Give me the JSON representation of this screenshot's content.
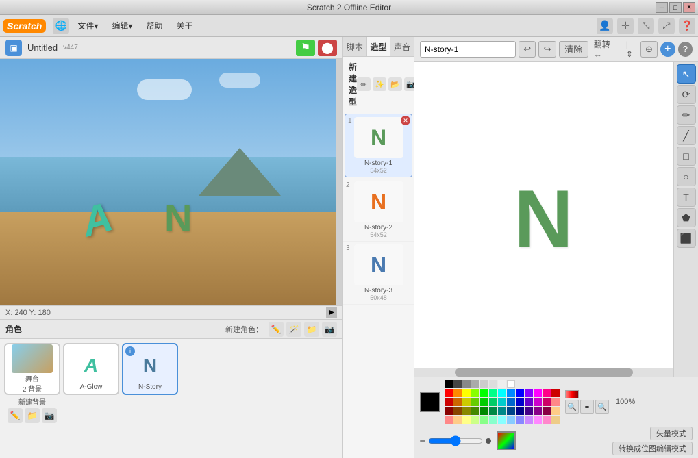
{
  "titlebar": {
    "title": "Scratch 2 Offline Editor"
  },
  "menubar": {
    "logo": "Scratch",
    "items": [
      "文件▾",
      "编辑▾",
      "帮助",
      "关于"
    ]
  },
  "stage": {
    "title": "Untitled",
    "version": "v447",
    "coords": "X: 240  Y: 180"
  },
  "tabs": {
    "scripts": "脚本",
    "costumes": "造型",
    "sounds": "声音"
  },
  "costumes": {
    "header": "新建造型",
    "items": [
      {
        "num": "1",
        "name": "N-story-1",
        "size": "54x52"
      },
      {
        "num": "2",
        "name": "N-story-2",
        "size": "54x52"
      },
      {
        "num": "3",
        "name": "N-story-3",
        "size": "50x48"
      }
    ]
  },
  "paint_editor": {
    "costume_name": "N-story-1",
    "undo_label": "↩",
    "redo_label": "↪",
    "clear_label": "清除",
    "flip_h": "翻转⇔",
    "flip_v": "翻转⇕",
    "help_label": "?",
    "zoom_pct": "100%",
    "vector_mode": "矢量模式",
    "bitmap_mode": "转换成位图编辑模式"
  },
  "tools": [
    "arrow",
    "curve",
    "pencil",
    "line",
    "rect",
    "ellipse",
    "text",
    "fill",
    "stamp"
  ],
  "chars": {
    "header": "角色",
    "new_label": "新建角色：",
    "items": [
      {
        "name": "舞台\n2 背景",
        "type": "stage"
      },
      {
        "name": "A-Glow",
        "type": "sprite-a"
      },
      {
        "name": "N-Story",
        "type": "sprite-n",
        "selected": true
      }
    ],
    "new_bg": "新建背景"
  },
  "palette": {
    "grays": [
      "#000000",
      "#444444",
      "#888888",
      "#bbbbbb",
      "#cccccc",
      "#dddddd",
      "#eeeeee",
      "#ffffff"
    ],
    "row1": [
      "#ff0000",
      "#ff8800",
      "#ffff00",
      "#88ff00",
      "#00ff00",
      "#00ff88",
      "#00ffff",
      "#0088ff",
      "#0000ff",
      "#8800ff",
      "#ff00ff",
      "#ff0088"
    ],
    "row2": [
      "#cc0000",
      "#cc6600",
      "#cccc00",
      "#66cc00",
      "#00cc00",
      "#00cc66",
      "#00cccc",
      "#0066cc",
      "#0000cc",
      "#6600cc",
      "#cc00cc",
      "#cc0066"
    ],
    "row3": [
      "#880000",
      "#884400",
      "#888800",
      "#448800",
      "#008800",
      "#008844",
      "#008888",
      "#004488",
      "#000088",
      "#440088",
      "#880088",
      "#880044"
    ],
    "row4": [
      "#ff8888",
      "#ffcc88",
      "#ffff88",
      "#ccff88",
      "#88ff88",
      "#88ffcc",
      "#88ffff",
      "#88ccff",
      "#8888ff",
      "#cc88ff",
      "#ff88ff",
      "#ff88cc"
    ]
  }
}
